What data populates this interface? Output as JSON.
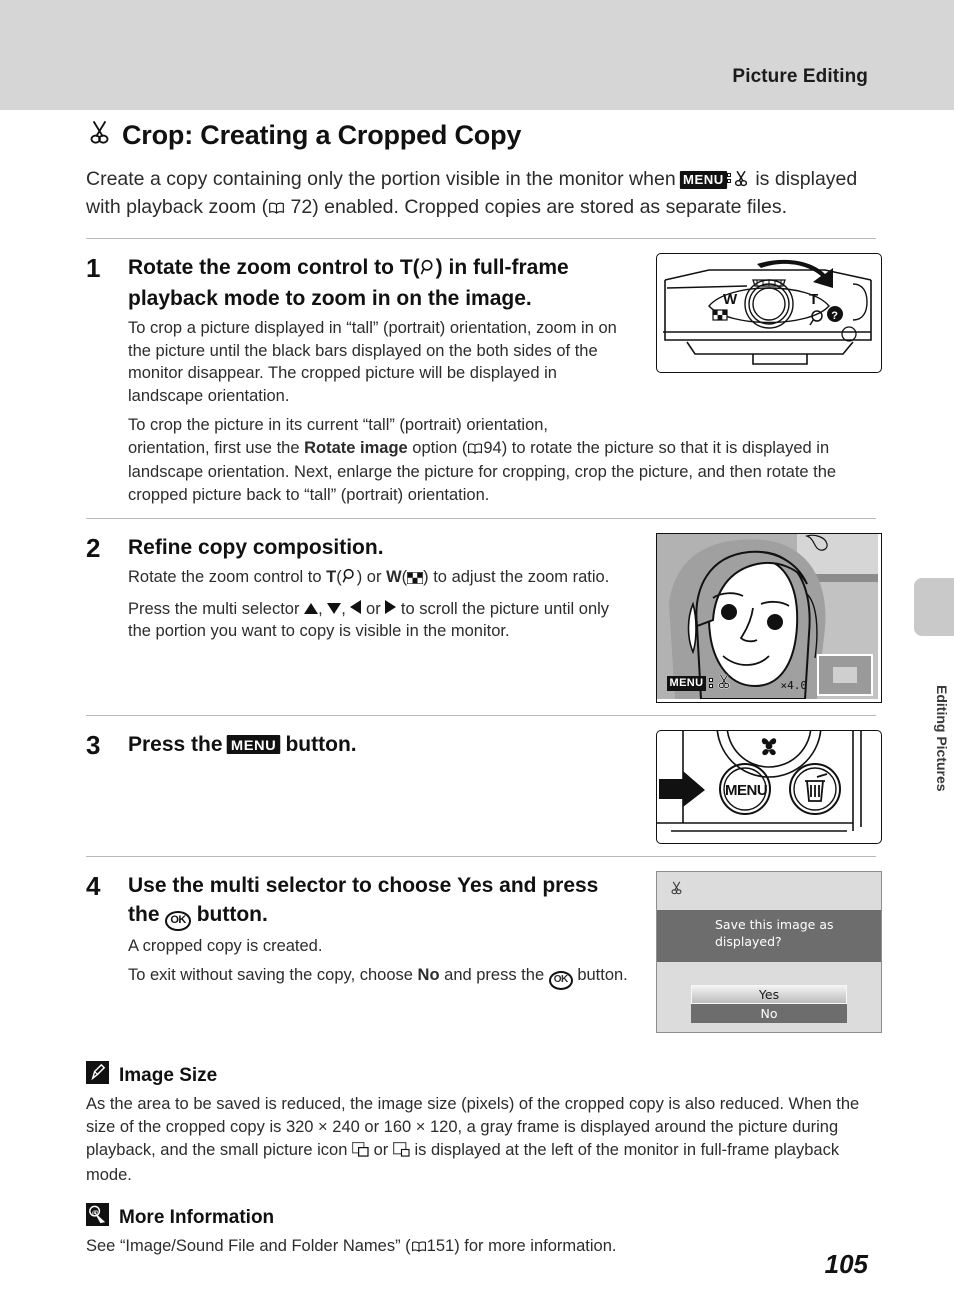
{
  "header": {
    "title": "Picture Editing"
  },
  "side_tab": {
    "label": "Editing Pictures"
  },
  "chapter": {
    "icon": "scissors-icon",
    "title": "Crop: Creating a Cropped Copy",
    "intro_before_menu": "Create a copy containing only the portion visible in the monitor when",
    "menu_label": "MENU",
    "intro_after_icons": "is displayed with playback zoom (",
    "intro_ref_page": "72",
    "intro_tail": ") enabled. Cropped copies are stored as separate files."
  },
  "steps": [
    {
      "number": "1",
      "heading_a": "Rotate the zoom control to",
      "heading_t": "T",
      "heading_b": "(",
      "heading_magnify": "magnify-icon",
      "heading_c": ") in full-frame playback mode to zoom in on the image.",
      "paragraphs": [
        "To crop a picture displayed in “tall” (portrait) orientation, zoom in on the picture until the black bars displayed on the both sides of the monitor disappear. The cropped picture will be displayed in landscape orientation.",
        "To crop the picture in its current “tall” (portrait) orientation, first use the Rotate image option (  94) to rotate the picture so that it is displayed in landscape orientation. Next, enlarge the picture for cropping, crop the picture, and then rotate the cropped picture back to “tall” (portrait) orientation."
      ],
      "para2_pre": "orientation, first use the ",
      "para2_bold": "Rotate image",
      "para2_mid": " option (",
      "para2_ref": "94",
      "para2_post": ") to rotate the picture so that it is displayed in landscape orientation. Next, enlarge the picture for cropping, crop the picture, and then rotate the cropped picture back to “tall” (portrait) orientation.",
      "para1": "To crop a picture displayed in “tall” (portrait) orientation, zoom in on the picture until the black bars displayed on the both sides of the monitor disappear. The cropped picture will be displayed in landscape orientation.",
      "para2_lead": "To crop the picture in its current “tall” (portrait) orientation,",
      "figure": "camera-top-zoom-control"
    },
    {
      "number": "2",
      "heading": "Refine copy composition.",
      "p1_a": "Rotate the zoom control to",
      "p1_t": "T",
      "p1_b": "(",
      "p1_c": ") or",
      "p1_w": "W",
      "p1_d": "(",
      "p1_e": ") to adjust the zoom ratio.",
      "p2_a": "Press the multi selector",
      "p2_b": "or",
      "p2_c": "to scroll the picture until only the portion you want to copy is visible in the monitor.",
      "figure": "monitor-portrait-crop-preview",
      "monitor_osd": {
        "menu_label": "MENU",
        "zoom_label": "×4.0"
      }
    },
    {
      "number": "3",
      "heading_a": "Press the",
      "heading_menu": "MENU",
      "heading_b": "button.",
      "figure": "camera-back-menu-button"
    },
    {
      "number": "4",
      "heading_a": "Use the multi selector to choose",
      "heading_yes": "Yes",
      "heading_b": "and press the",
      "heading_ok": "OK",
      "heading_c": "button.",
      "p1": "A cropped copy is created.",
      "p2_a": "To exit without saving the copy, choose",
      "p2_no": "No",
      "p2_b": "and press the",
      "p2_c": "button.",
      "figure": "confirm-save-dialog",
      "dialog": {
        "icon": "scissors-icon",
        "message_line1": "Save this image as",
        "message_line2": "displayed?",
        "yes_label": "Yes",
        "no_label": "No"
      }
    }
  ],
  "notes": [
    {
      "icon": "pencil-note-icon",
      "title": "Image Size",
      "body_a": "As the area to be saved is reduced, the image size (pixels) of the cropped copy is also reduced. When the size of the cropped copy is 320 × 240 or 160 × 120, a gray frame is displayed around the picture during playback, and the small picture icon",
      "body_or": "or",
      "body_b": "is displayed at the left of the monitor in full-frame playback mode."
    },
    {
      "icon": "more-info-icon",
      "title": "More Information",
      "body_a": "See “Image/Sound File and Folder Names” (",
      "ref_page": "151",
      "body_b": ") for more information."
    }
  ],
  "page_number": "105",
  "colors": {
    "header_band": "#d6d6d6",
    "side_tab": "#c9c9c9",
    "dialog_bg": "#dcdcdc",
    "dialog_band": "#6d6d6d",
    "text": "#2c2c2c"
  }
}
